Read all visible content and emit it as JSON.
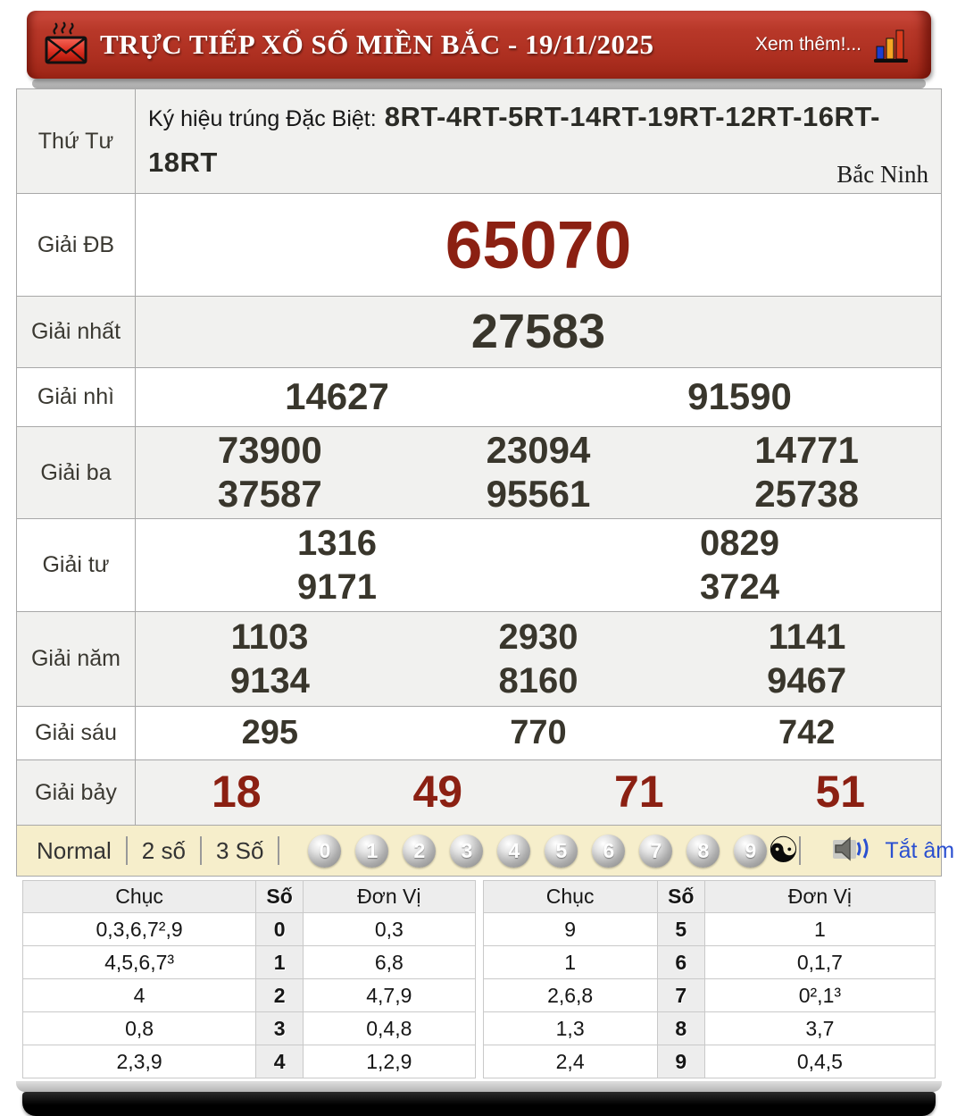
{
  "header": {
    "title": "TRỰC TIẾP XỔ SỐ MIỀN BẮC - 19/11/2025",
    "more_link": "Xem thêm!..."
  },
  "results": {
    "day_label": "Thứ Tư",
    "special_sign_label": "Ký hiệu trúng Đặc Biệt:",
    "special_sign_code": "8RT-4RT-5RT-14RT-19RT-12RT-16RT-18RT",
    "province": "Bắc Ninh",
    "prizes": [
      {
        "id": "giai-db",
        "label": "Giải ĐB",
        "style": "special",
        "lines": [
          [
            "65070"
          ]
        ]
      },
      {
        "id": "giai-nhat",
        "label": "Giải nhất",
        "style": "normal",
        "lines": [
          [
            "27583"
          ]
        ]
      },
      {
        "id": "giai-nhi",
        "label": "Giải nhì",
        "style": "normal",
        "lines": [
          [
            "14627",
            "91590"
          ]
        ]
      },
      {
        "id": "giai-ba",
        "label": "Giải ba",
        "style": "normal",
        "lines": [
          [
            "73900",
            "23094",
            "14771"
          ],
          [
            "37587",
            "95561",
            "25738"
          ]
        ]
      },
      {
        "id": "giai-tu",
        "label": "Giải tư",
        "style": "normal",
        "lines": [
          [
            "1316",
            "0829"
          ],
          [
            "9171",
            "3724"
          ]
        ]
      },
      {
        "id": "giai-nam",
        "label": "Giải năm",
        "style": "normal",
        "lines": [
          [
            "1103",
            "2930",
            "1141"
          ],
          [
            "9134",
            "8160",
            "9467"
          ]
        ]
      },
      {
        "id": "giai-sau",
        "label": "Giải sáu",
        "style": "normal",
        "lines": [
          [
            "295",
            "770",
            "742"
          ]
        ]
      },
      {
        "id": "giai-bay",
        "label": "Giải bảy",
        "style": "red",
        "lines": [
          [
            "18",
            "49",
            "71",
            "51"
          ]
        ]
      }
    ]
  },
  "toolbar": {
    "modes": [
      "Normal",
      "2 số",
      "3 Số"
    ],
    "balls": [
      "0",
      "1",
      "2",
      "3",
      "4",
      "5",
      "6",
      "7",
      "8",
      "9"
    ],
    "yinyang_glyph": "☯",
    "mute_label": "Tắt âm"
  },
  "summary": {
    "tables": [
      {
        "headers": [
          "Chục",
          "Số",
          "Đơn Vị"
        ],
        "rows": [
          [
            "0,3,6,7²,9",
            "0",
            "0,3"
          ],
          [
            "4,5,6,7³",
            "1",
            "6,8"
          ],
          [
            "4",
            "2",
            "4,7,9"
          ],
          [
            "0,8",
            "3",
            "0,4,8"
          ],
          [
            "2,3,9",
            "4",
            "1,2,9"
          ]
        ]
      },
      {
        "headers": [
          "Chục",
          "Số",
          "Đơn Vị"
        ],
        "rows": [
          [
            "9",
            "5",
            "1"
          ],
          [
            "1",
            "6",
            "0,1,7"
          ],
          [
            "2,6,8",
            "7",
            "0²,1³"
          ],
          [
            "1,3",
            "8",
            "3,7"
          ],
          [
            "2,4",
            "9",
            "0,4,5"
          ]
        ]
      }
    ]
  },
  "colors": {
    "banner_red": "#b23528",
    "special_red": "#8b2012",
    "link_blue": "#2b50d0",
    "toolbar_cream": "#f6eecb"
  }
}
